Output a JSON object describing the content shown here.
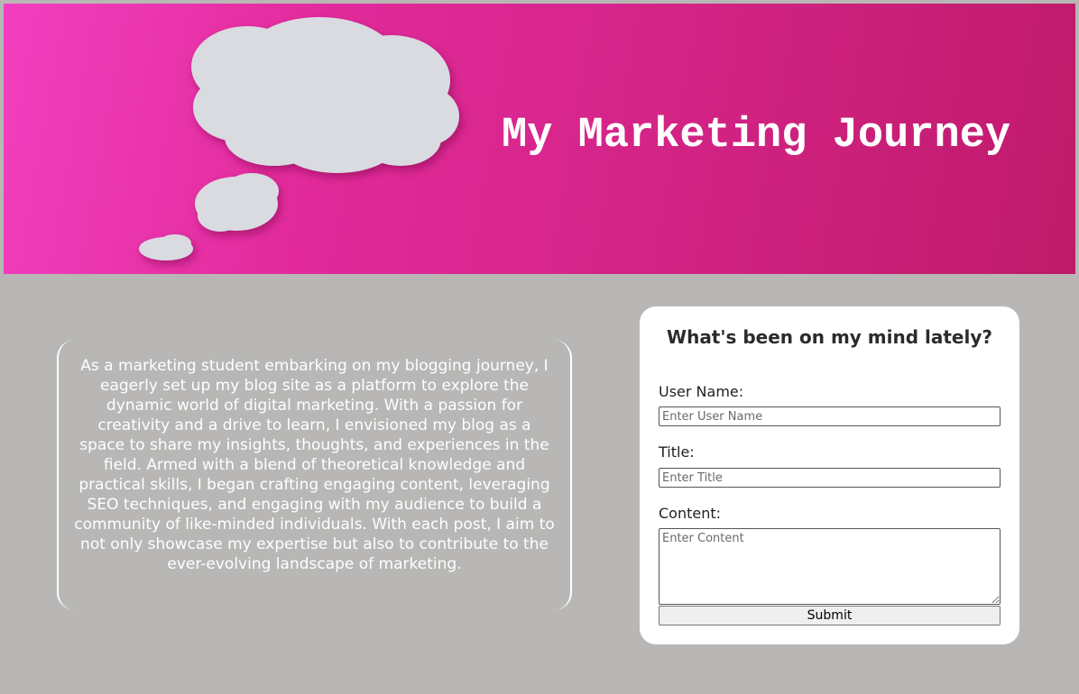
{
  "banner": {
    "title": "My Marketing Journey"
  },
  "intro": {
    "text": "As a marketing student embarking on my blogging journey, I eagerly set up my blog site as a platform to explore the dynamic world of digital marketing. With a passion for creativity and a drive to learn, I envisioned my blog as a space to share my insights, thoughts, and experiences in the field. Armed with a blend of theoretical knowledge and practical skills, I began crafting engaging content, leveraging SEO techniques, and engaging with my audience to build a community of like-minded individuals. With each post, I aim to not only showcase my expertise but also to contribute to the ever-evolving landscape of marketing."
  },
  "form": {
    "heading": "What's been on my mind lately?",
    "username": {
      "label": "User Name:",
      "placeholder": "Enter User Name",
      "value": ""
    },
    "title": {
      "label": "Title:",
      "placeholder": "Enter Title",
      "value": ""
    },
    "content": {
      "label": "Content:",
      "placeholder": "Enter Content",
      "value": ""
    },
    "submit_label": "Submit"
  },
  "colors": {
    "page_background": "#b8b7b5",
    "banner_pink": "#e22a9b",
    "card_background": "#ffffff",
    "text_light": "#ffffff"
  },
  "icons": {
    "banner_image": "thought-bubble-cloud-icon"
  }
}
